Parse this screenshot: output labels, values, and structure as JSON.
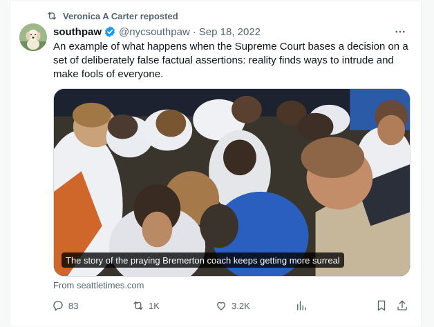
{
  "repost": {
    "label": "Veronica A Carter reposted"
  },
  "author": {
    "name": "southpaw",
    "handle": "@nycsouthpaw",
    "separator": "·",
    "date": "Sep 18, 2022"
  },
  "tweet": {
    "text": "An example of what happens when the Supreme Court bases a decision on a set of deliberately false factual assertions: reality finds ways to intrude and make fools of everyone."
  },
  "media": {
    "caption": "The story of the praying Bremerton coach keeps getting more surreal"
  },
  "link_source": "From seattletimes.com",
  "actions": {
    "replies": "83",
    "reposts": "1K",
    "likes": "3.2K"
  },
  "colors": {
    "text": "#0f1419",
    "secondary": "#536471",
    "verified": "#1d9bf0",
    "background": "#f7f9f9",
    "border": "#cfd9de"
  },
  "icons": {
    "repost": "repost-icon",
    "verified": "verified-badge-icon",
    "more": "more-icon",
    "reply": "reply-icon",
    "like": "like-icon",
    "views": "views-icon",
    "bookmark": "bookmark-icon",
    "share": "share-icon"
  }
}
